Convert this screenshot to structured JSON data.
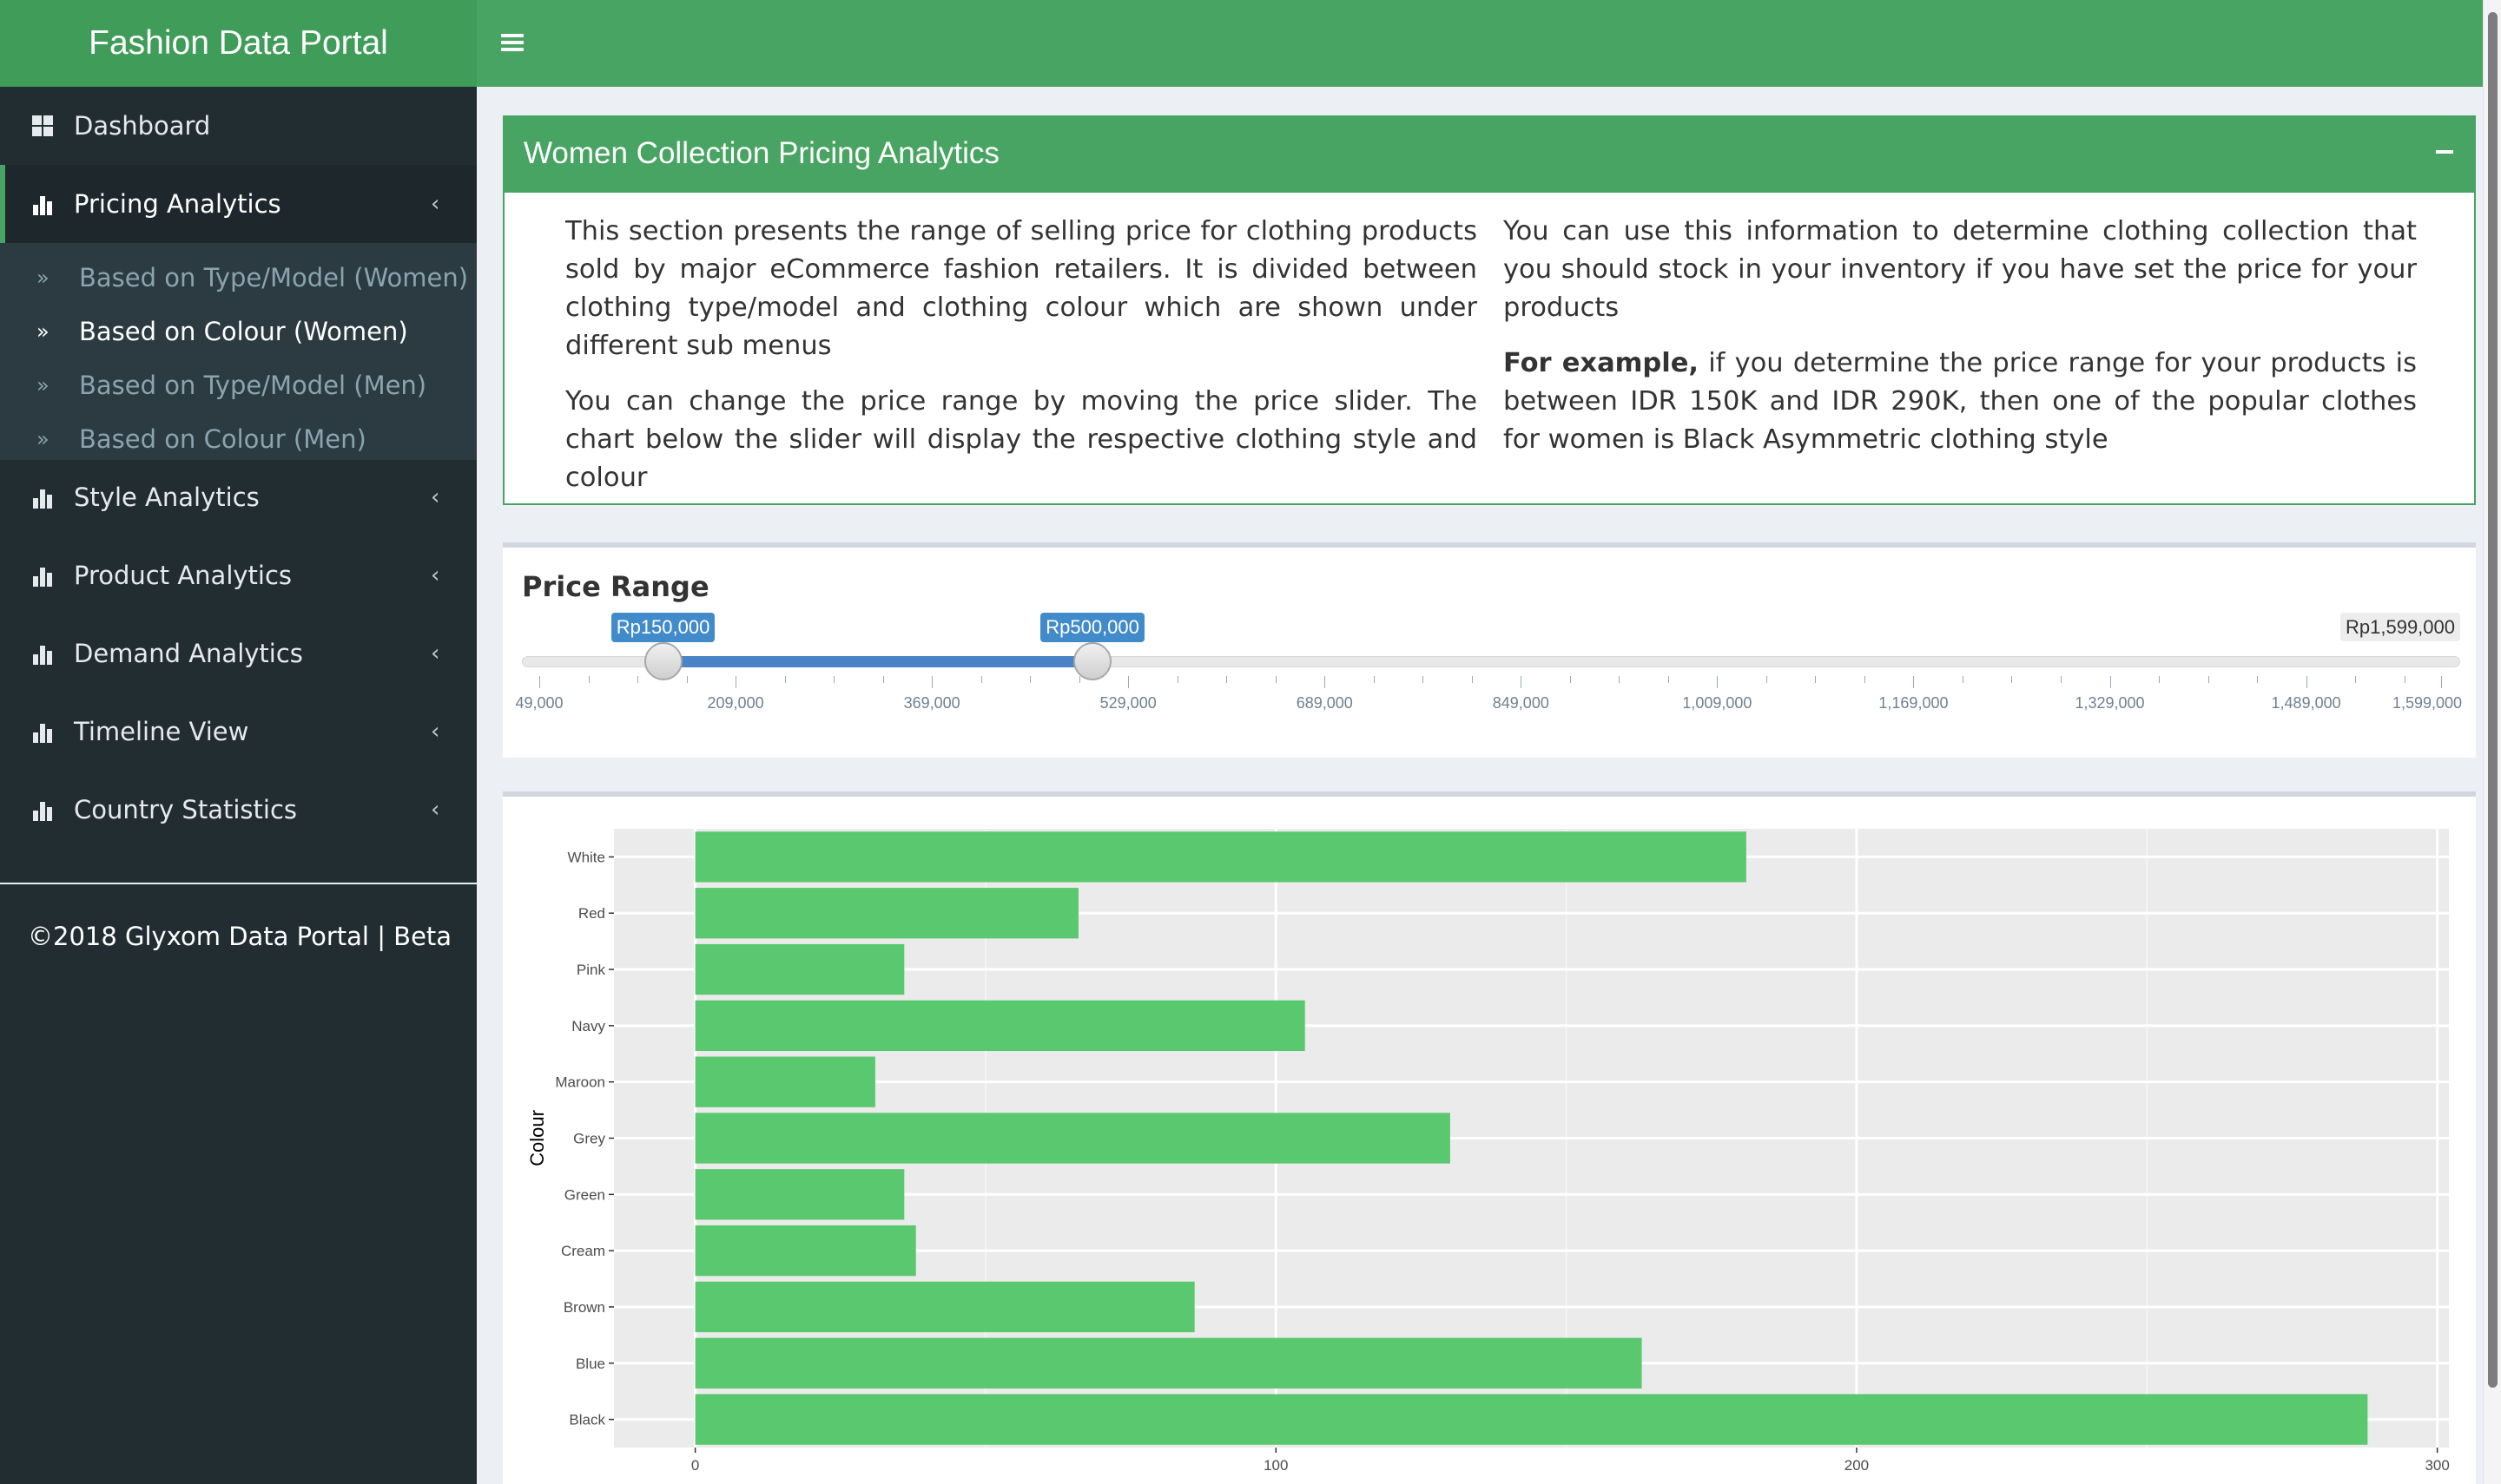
{
  "header": {
    "app_title": "Fashion Data Portal"
  },
  "sidebar": {
    "items": [
      {
        "label": "Dashboard",
        "icon": "dashboard-icon"
      },
      {
        "label": "Pricing Analytics",
        "icon": "bar-chart-icon",
        "active": true
      },
      {
        "label": "Style Analytics",
        "icon": "bar-chart-icon"
      },
      {
        "label": "Product Analytics",
        "icon": "bar-chart-icon"
      },
      {
        "label": "Demand Analytics",
        "icon": "bar-chart-icon"
      },
      {
        "label": "Timeline View",
        "icon": "bar-chart-icon"
      },
      {
        "label": "Country Statistics",
        "icon": "bar-chart-icon"
      }
    ],
    "chevron": "‹",
    "sub_icon": "»",
    "submenu": [
      {
        "label": "Based on Type/Model (Women)"
      },
      {
        "label": "Based on Colour (Women)",
        "active": true
      },
      {
        "label": "Based on Type/Model (Men)"
      },
      {
        "label": "Based on Colour (Men)"
      }
    ],
    "footer": "©2018 Glyxom Data Portal | Beta"
  },
  "info_box": {
    "title": "Women Collection Pricing Analytics",
    "col1_p1": "This section presents the range of selling price for clothing products sold by major eCommerce fashion retailers. It is divided between clothing type/model and clothing colour which are shown under different sub menus",
    "col1_p2": "You can change the price range by moving the price slider. The chart below the slider will display the respective clothing style and colour",
    "col2_p1": "You can use this information to determine clothing collection that you should stock in your inventory if you have set the price for your products",
    "col2_p2_bold": "For example,",
    "col2_p2_rest": " if you determine the price range for your products is between IDR 150K and IDR 290K, then one of the popular clothes for women is Black Asymmetric clothing style"
  },
  "price_range": {
    "title": "Price Range",
    "min": 49000,
    "max": 1599000,
    "from": 150000,
    "to": 500000,
    "from_label": "Rp150,000",
    "to_label": "Rp500,000",
    "max_label": "Rp1,599,000",
    "tick_labels": [
      "49,000",
      "209,000",
      "369,000",
      "529,000",
      "689,000",
      "849,000",
      "1,009,000",
      "1,169,000",
      "1,329,000",
      "1,489,000",
      "1,599,000"
    ],
    "fill_color": "#4a83c6"
  },
  "chart_data": {
    "type": "bar",
    "orientation": "horizontal",
    "ylabel": "Colour",
    "categories": [
      "White",
      "Red",
      "Pink",
      "Navy",
      "Maroon",
      "Grey",
      "Green",
      "Cream",
      "Brown",
      "Blue",
      "Black"
    ],
    "values": [
      181,
      66,
      36,
      105,
      31,
      130,
      36,
      38,
      86,
      163,
      288
    ],
    "xlim": [
      -14,
      302
    ],
    "x_ticks": [
      0,
      100,
      200,
      300
    ],
    "grid": true,
    "bar_color": "#5ac86e",
    "panel_color": "#ebebeb"
  }
}
